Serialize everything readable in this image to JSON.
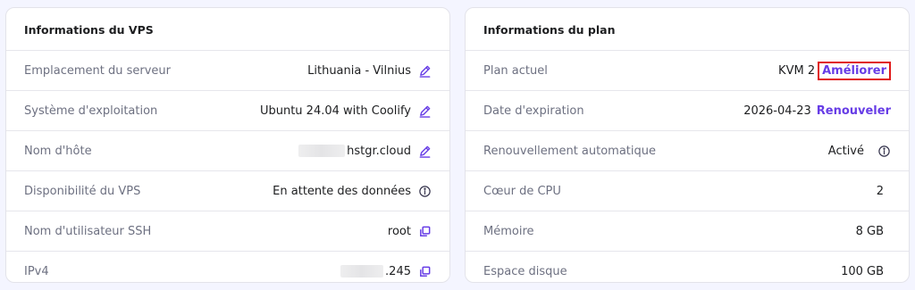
{
  "vps": {
    "title": "Informations du VPS",
    "rows": [
      {
        "label": "Emplacement du serveur",
        "value": "Lithuania - Vilnius",
        "icon": "pencil-icon"
      },
      {
        "label": "Système d'exploitation",
        "value": "Ubuntu 24.04 with Coolify",
        "icon": "pencil-icon"
      },
      {
        "label": "Nom d'hôte",
        "value": "hstgr.cloud",
        "icon": "pencil-icon"
      },
      {
        "label": "Disponibilité du VPS",
        "value": "En attente des données",
        "icon": "info-icon"
      },
      {
        "label": "Nom d'utilisateur SSH",
        "value": "root",
        "icon": "copy-icon"
      },
      {
        "label": "IPv4",
        "value": ".245",
        "icon": "copy-icon"
      }
    ]
  },
  "plan": {
    "title": "Informations du plan",
    "rows": [
      {
        "label": "Plan actuel",
        "value": "KVM 2",
        "action": "Améliorer"
      },
      {
        "label": "Date d'expiration",
        "value": "2026-04-23",
        "action": "Renouveler"
      },
      {
        "label": "Renouvellement automatique",
        "value": "Activé",
        "icon": "info-icon"
      },
      {
        "label": "Cœur de CPU",
        "value": "2"
      },
      {
        "label": "Mémoire",
        "value": "8 GB"
      },
      {
        "label": "Espace disque",
        "value": "100 GB"
      }
    ]
  },
  "colors": {
    "accent": "#673de6",
    "highlight_box": "#e01a1a",
    "label_text": "#6d7081",
    "background": "#f4f5ff"
  }
}
